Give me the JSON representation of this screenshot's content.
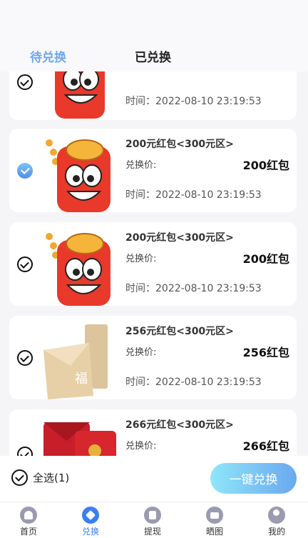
{
  "tabs": {
    "pending": "待兑换",
    "done": "已兑换"
  },
  "cards": [
    {
      "title": "",
      "price_label": "",
      "price": "",
      "time": "时间：2022-08-10 23:19:53",
      "checked": false
    },
    {
      "title": "200元红包<300元区>",
      "price_label": "兑换价:",
      "price": "200红包",
      "time": "时间：2022-08-10 23:19:53",
      "checked": true
    },
    {
      "title": "200元红包<300元区>",
      "price_label": "兑换价:",
      "price": "200红包",
      "time": "时间：2022-08-10 23:19:53",
      "checked": false
    },
    {
      "title": "256元红包<300元区>",
      "price_label": "兑换价:",
      "price": "256红包",
      "time": "时间：2022-08-10 23:19:53",
      "checked": false
    },
    {
      "title": "266元红包<300元区>",
      "price_label": "兑换价:",
      "price": "266红包",
      "time": "",
      "checked": false
    }
  ],
  "bottom": {
    "select_all": "全选(1)",
    "exchange": "一键兑换"
  },
  "nav": [
    {
      "label": "首页",
      "icon": "home-icon"
    },
    {
      "label": "兑换",
      "icon": "exchange-icon",
      "active": true
    },
    {
      "label": "提现",
      "icon": "withdraw-icon"
    },
    {
      "label": "晒图",
      "icon": "camera-icon"
    },
    {
      "label": "我的",
      "icon": "user-icon"
    }
  ]
}
